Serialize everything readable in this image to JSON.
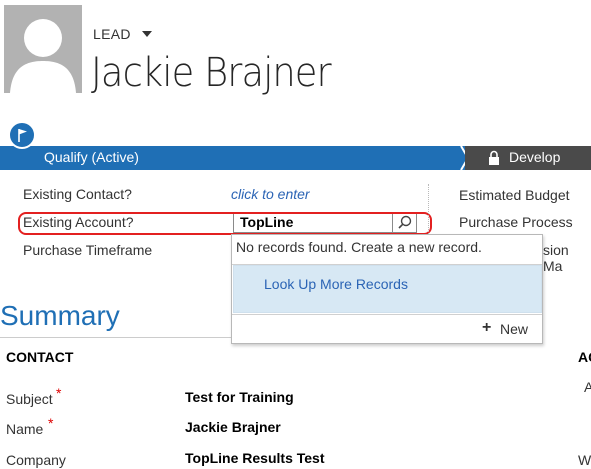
{
  "header": {
    "entity_type": "LEAD",
    "record_name": "Jackie Brajner"
  },
  "process": {
    "active_stage": "Qualify (Active)",
    "next_stage": "Develop"
  },
  "fields": {
    "existing_contact_label": "Existing Contact?",
    "existing_contact_value": "click to enter",
    "existing_account_label": "Existing Account?",
    "existing_account_value": "TopLine",
    "purchase_timeframe_label": "Purchase Timeframe",
    "estimated_budget_label": "Estimated Budget",
    "purchase_process_label": "Purchase Process",
    "decision_maker_label_partial": "sion Ma"
  },
  "lookup_dropdown": {
    "message": "No records found. Create a new record.",
    "look_up_more": "Look Up More Records",
    "new_label": "New"
  },
  "summary": {
    "title": "Summary",
    "contact_heading": "CONTACT",
    "right_heading_partial": "AC",
    "right_partial_1": "A",
    "right_partial_2": "W",
    "rows": [
      {
        "label": "Subject",
        "value": "Test for Training"
      },
      {
        "label": "Name",
        "value": "Jackie Brajner"
      },
      {
        "label": "Company",
        "value": "TopLine Results Test"
      }
    ]
  },
  "colors": {
    "accent": "#1f6fb5",
    "highlight": "#e32020",
    "link": "#2b64b5"
  }
}
